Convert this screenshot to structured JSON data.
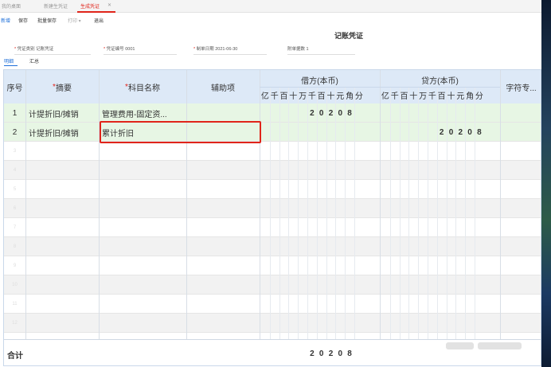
{
  "tabs": [
    "我的桌面",
    "新建生凭证",
    "生成凭证"
  ],
  "toolbar": {
    "new": "新增",
    "save": "保存",
    "batch_save": "批量保存",
    "print": "打印 ▾",
    "back": "退出"
  },
  "doc_title": "记账凭证",
  "fields": {
    "voucher_type_label": "凭证类别",
    "voucher_type_value": "记账凭证",
    "voucher_no_label": "凭证编号",
    "voucher_no_value": "0001",
    "date_label": "制单日期",
    "date_value": "2021-06-30",
    "attach_label": "附单据数",
    "attach_value": "1"
  },
  "subtabs": [
    "明细",
    "汇总"
  ],
  "columns": {
    "index": "序号",
    "summary": "摘要",
    "account": "科目名称",
    "aux": "辅助项",
    "debit": "借方(本币)",
    "credit": "贷方(本币)",
    "extra": "字符专..."
  },
  "digit_units": [
    "亿",
    "千",
    "百",
    "十",
    "万",
    "千",
    "百",
    "十",
    "元",
    "角",
    "分"
  ],
  "rows": [
    {
      "index": "1",
      "summary": "计提折旧/摊销",
      "account": "管理费用-固定资...",
      "debit_digits": [
        "",
        "",
        "",
        "",
        "",
        "2",
        "0",
        "2",
        "0",
        "8",
        ""
      ],
      "credit_digits": [
        "",
        "",
        "",
        "",
        "",
        "",
        "",
        "",
        "",
        "",
        ""
      ]
    },
    {
      "index": "2",
      "summary": "计提折旧/摊销",
      "account": "累计折旧",
      "debit_digits": [
        "",
        "",
        "",
        "",
        "",
        "",
        "",
        "",
        "",
        "",
        ""
      ],
      "credit_digits": [
        "",
        "",
        "",
        "",
        "",
        "",
        "2",
        "0",
        "2",
        "0",
        "8"
      ]
    },
    {
      "index": "3"
    },
    {
      "index": "4"
    },
    {
      "index": "5"
    },
    {
      "index": "6"
    },
    {
      "index": "7"
    },
    {
      "index": "8"
    },
    {
      "index": "9"
    },
    {
      "index": "10"
    },
    {
      "index": "11"
    },
    {
      "index": "12"
    }
  ],
  "total": {
    "label": "合计",
    "debit_digits": [
      "",
      "",
      "",
      "",
      "",
      "2",
      "0",
      "2",
      "0",
      "8",
      ""
    ]
  }
}
